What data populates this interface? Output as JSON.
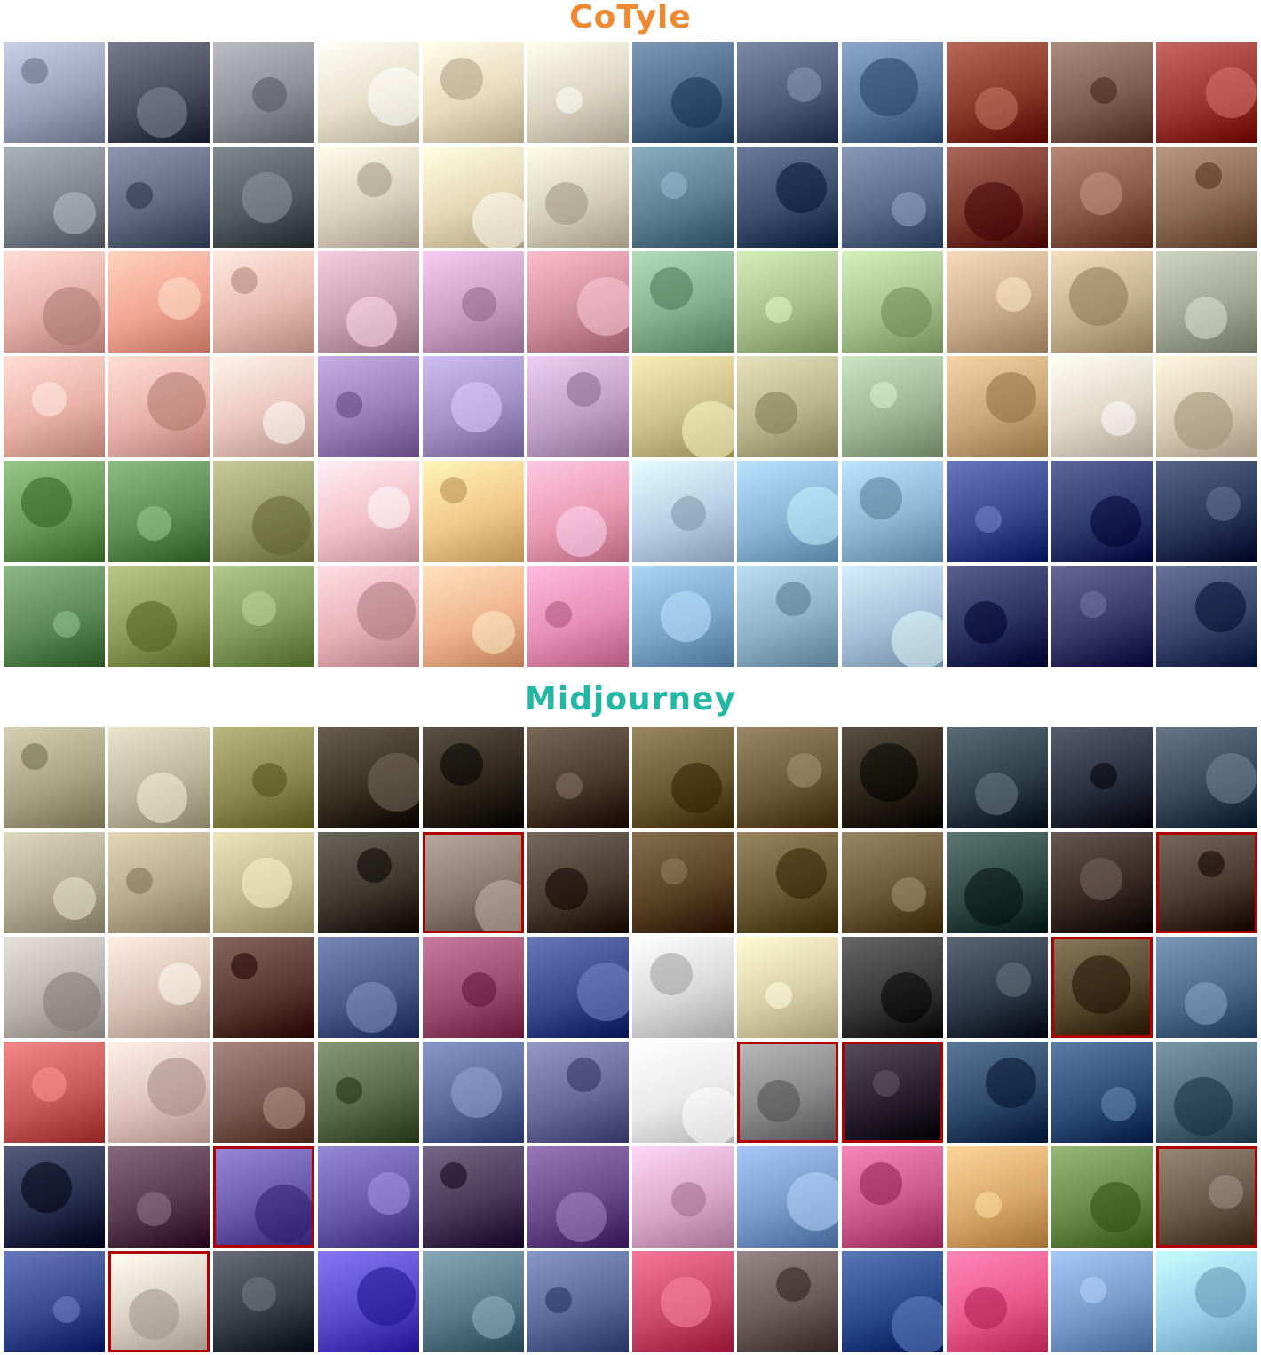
{
  "sections": [
    {
      "title": "CoTyle",
      "title_color": "#f0892f",
      "rows": [
        [
          "#9aa3ba",
          "#4b4d60",
          "#8f9097",
          "#e7e0cb",
          "#e9d9bd",
          "#dbd4c1",
          "#4f6d8a",
          "#4e5e7a",
          "#5f7a9c",
          "#8c3a2a",
          "#7e5f52",
          "#9a3a35"
        ],
        [
          "#7e858e",
          "#626a83",
          "#545c60",
          "#d9d1bd",
          "#e5d6b6",
          "#d6d0ba",
          "#5f7f93",
          "#3c4f6d",
          "#5a6d8a",
          "#7a3a2f",
          "#8b5a4a",
          "#8a6b55"
        ],
        [
          "#e6b0a8",
          "#f1a592",
          "#e7bcb1",
          "#c7a1b0",
          "#c9a0c3",
          "#d08f9e",
          "#86b08d",
          "#a8c08c",
          "#a7c38e",
          "#c9ad8c",
          "#c7b18e",
          "#a2a896"
        ],
        [
          "#eab1a7",
          "#eab2a8",
          "#e9c6bd",
          "#9b7fbb",
          "#a291c5",
          "#c3a0c6",
          "#cdc08a",
          "#b9b58e",
          "#9eb896",
          "#c9a779",
          "#e0d7c7",
          "#d9cbb3"
        ],
        [
          "#6a9a5a",
          "#5f8f55",
          "#9a9e6a",
          "#f3c1c9",
          "#f0c88b",
          "#e99bb4",
          "#b7d0e6",
          "#8bb6d4",
          "#8fb7d1",
          "#3a4a8f",
          "#2f3b70",
          "#2b3a5a"
        ],
        [
          "#5f8a59",
          "#8d9a5a",
          "#829c5e",
          "#e8b0b8",
          "#f0b58f",
          "#e78eb3",
          "#7ea8c9",
          "#8fb1c7",
          "#a6c1d7",
          "#2b3362",
          "#3b3a6a",
          "#3a476a"
        ]
      ]
    },
    {
      "title": "Midjourney",
      "title_color": "#22b8a4",
      "rows": [
        [
          "#a8a385",
          "#bdb79d",
          "#8b8a52",
          "#3c3221",
          "#2f261b",
          "#4c3a2b",
          "#6b5a32",
          "#6c5a3a",
          "#2c2418",
          "#2f3f4a",
          "#2b2f3f",
          "#3a4a5a"
        ],
        [
          "#b1ab94",
          "#b8a98c",
          "#c1b890",
          "#3f3a30",
          "#8a7a70",
          "#4a3c30",
          "#5a4325",
          "#6b5a35",
          "#6a5a3a",
          "#2f4a45",
          "#3a2a25",
          "#4a3a30"
        ],
        [
          "#b9b4b0",
          "#d9c1b4",
          "#5a3a30",
          "#4a5a8a",
          "#9a4f6f",
          "#3a4a8a",
          "#d9d9d9",
          "#d9cfa8",
          "#3a3a3a",
          "#2f3a48",
          "#5a4a30",
          "#4f6a8a"
        ],
        [
          "#c95a5a",
          "#e0c2bd",
          "#7a5a4f",
          "#5a6a4a",
          "#5a6a9a",
          "#6a6a9a",
          "#e9e9e9",
          "#8a8a8a",
          "#2a1f2f",
          "#2f4a6a",
          "#2f4f7a",
          "#4f6a7a"
        ],
        [
          "#2a2f4f",
          "#5a3a4f",
          "#6a5aaa",
          "#6a5aaa",
          "#4a3a5a",
          "#6a4a8a",
          "#d9a8c8",
          "#7a9acb",
          "#c95a8a",
          "#d9a86a",
          "#6a8a4a",
          "#6a5a4a"
        ],
        [
          "#3a4a8f",
          "#d9d0c5",
          "#3a3f4a",
          "#5a4ac9",
          "#5a7a8a",
          "#5a6a9a",
          "#c94a6a",
          "#6a5a5a",
          "#2a4a8a",
          "#e95a8a",
          "#7a9acb",
          "#9ad0e9"
        ]
      ],
      "highlighted": [
        [
          1,
          4
        ],
        [
          1,
          11
        ],
        [
          2,
          10
        ],
        [
          3,
          7
        ],
        [
          3,
          8
        ],
        [
          4,
          2
        ],
        [
          4,
          11
        ],
        [
          5,
          1
        ]
      ]
    }
  ]
}
